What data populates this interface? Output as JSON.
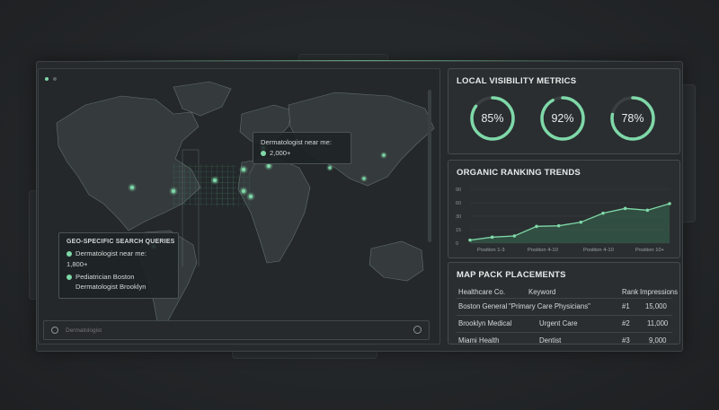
{
  "map": {
    "tooltip_top": {
      "line1": "Dermatologist near me:",
      "line2": "2,000+"
    },
    "overlay": {
      "title": "GEO-SPECIFIC SEARCH QUERIES",
      "item1_label": "Dermatologist near me:",
      "item1_value": "1,800+",
      "item2_line1": "Pediatrician Boston",
      "item2_line2": "Dermatologist Brooklyn"
    },
    "search_placeholder": "Dermatologist"
  },
  "visibility": {
    "title": "LOCAL VISIBILITY METRICS",
    "gauges": [
      {
        "label": "85%",
        "value": 85
      },
      {
        "label": "92%",
        "value": 92
      },
      {
        "label": "78%",
        "value": 78
      }
    ]
  },
  "chart_data": {
    "type": "area",
    "title": "ORGANIC RANKING TRENDS",
    "y_ticks": [
      "90",
      "60",
      "30",
      "15",
      "0"
    ],
    "x_labels": [
      "Position 1-3",
      "Position 4-10",
      "Position 4-10",
      "Position 10+"
    ],
    "x": [
      0,
      1,
      2,
      3,
      4,
      5,
      6,
      7,
      8,
      9
    ],
    "values": [
      5,
      10,
      12,
      28,
      29,
      35,
      50,
      58,
      55,
      66
    ],
    "ylim": [
      0,
      90
    ],
    "accent": "#7fd8a8"
  },
  "map_pack": {
    "title": "MAP PACK PLACEMENTS",
    "headers": [
      "Healthcare Co.",
      "Keyword",
      "Rank",
      "Impressions"
    ],
    "rows": [
      [
        "Boston General",
        "\"Primary Care Physicians\"",
        "#1",
        "15,000"
      ],
      [
        "Brooklyn Medical",
        "Urgent Care",
        "#2",
        "11,000"
      ],
      [
        "Miami Health",
        "Dentist",
        "#3",
        "9,000"
      ]
    ]
  },
  "colors": {
    "accent": "#7fd8a8",
    "accent_dark": "#3f8a63",
    "panel": "#2a2e30"
  }
}
